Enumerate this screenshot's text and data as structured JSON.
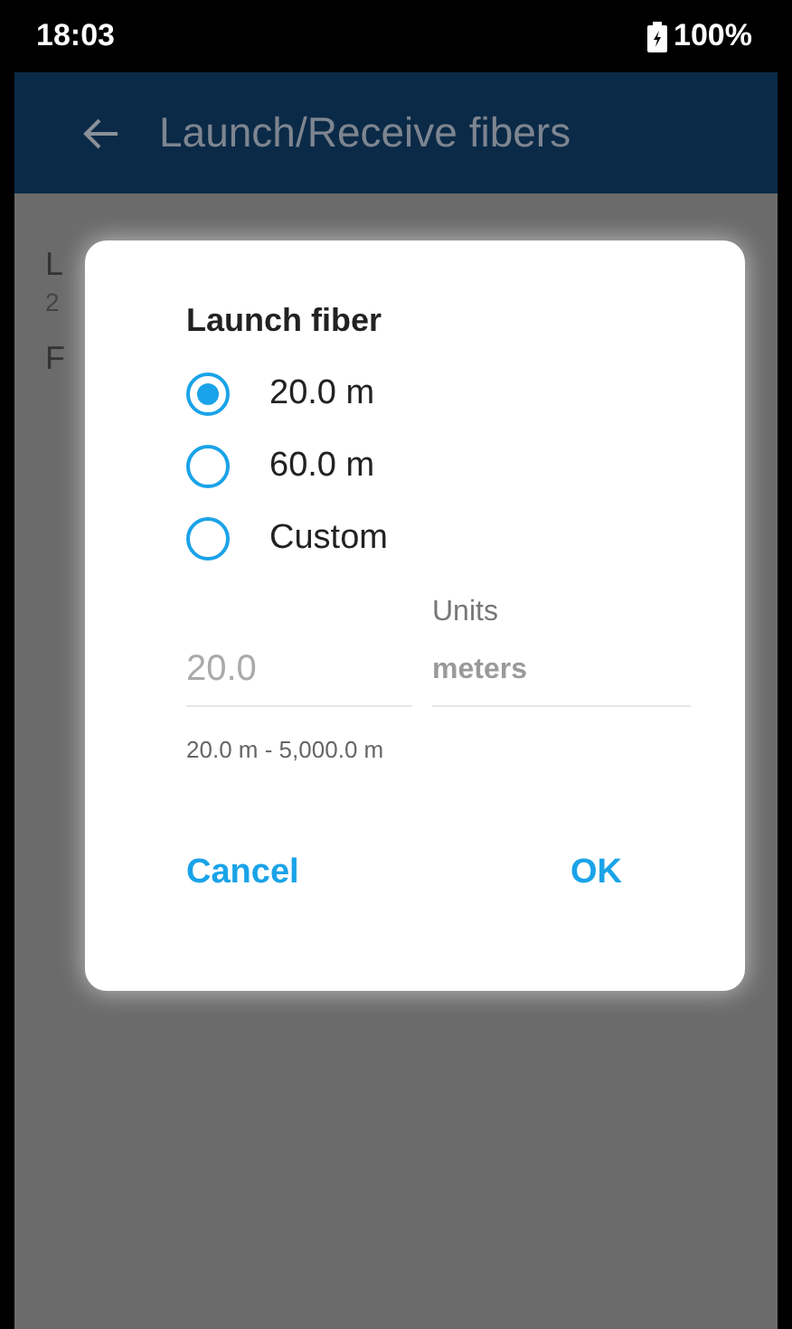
{
  "status_bar": {
    "time": "18:03",
    "battery": "100%"
  },
  "app_bar": {
    "title": "Launch/Receive fibers"
  },
  "background_items": [
    {
      "kind": "title",
      "text": "L"
    },
    {
      "kind": "sub",
      "text": "2"
    },
    {
      "kind": "title",
      "text": "F"
    }
  ],
  "dialog": {
    "title": "Launch fiber",
    "options": [
      {
        "label": "20.0 m",
        "selected": true
      },
      {
        "label": "60.0 m",
        "selected": false
      },
      {
        "label": "Custom",
        "selected": false
      }
    ],
    "length_field": {
      "value": "20.0",
      "disabled": true
    },
    "units_field": {
      "label": "Units",
      "value": "meters"
    },
    "hint": "20.0 m - 5,000.0 m",
    "buttons": [
      "Cancel",
      "OK"
    ]
  }
}
